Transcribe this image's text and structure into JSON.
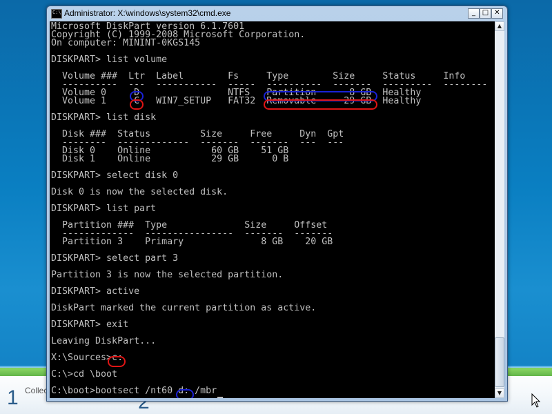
{
  "window": {
    "title": "Administrator: X:\\windows\\system32\\cmd.exe",
    "icon": "cmd-icon",
    "controls": {
      "minimize": "_",
      "maximize": "□",
      "close": "✕"
    }
  },
  "console": {
    "lines": [
      "Microsoft DiskPart version 6.1.7601",
      "Copyright (C) 1999-2008 Microsoft Corporation.",
      "On computer: MININT-0KGS145",
      "",
      "DISKPART> list volume",
      "",
      "  Volume ###  Ltr  Label        Fs     Type        Size     Status     Info",
      "  ----------  ---  -----------  -----  ----------  -------  ---------  --------",
      "  Volume 0     D                NTFS   Partition      8 GB  Healthy",
      "  Volume 1     C   WIN7_SETUP   FAT32  Removable     29 GB  Healthy",
      "",
      "DISKPART> list disk",
      "",
      "  Disk ###  Status         Size     Free     Dyn  Gpt",
      "  --------  -------------  -------  -------  ---  ---",
      "  Disk 0    Online           60 GB    51 GB",
      "  Disk 1    Online           29 GB      0 B",
      "",
      "DISKPART> select disk 0",
      "",
      "Disk 0 is now the selected disk.",
      "",
      "DISKPART> list part",
      "",
      "  Partition ###  Type              Size     Offset",
      "  -------------  ----------------  -------  -------",
      "  Partition 3    Primary              8 GB    20 GB",
      "",
      "DISKPART> select part 3",
      "",
      "Partition 3 is now the selected partition.",
      "",
      "DISKPART> active",
      "",
      "DiskPart marked the current partition as active.",
      "",
      "DISKPART> exit",
      "",
      "Leaving DiskPart...",
      "",
      "X:\\Sources>c:",
      "",
      "C:\\>cd \\boot",
      "",
      "C:\\boot>bootsect /nt60 d: /mbr"
    ]
  },
  "desktop": {
    "step_1": "1",
    "step_2": "2",
    "collect_label": "Collec",
    "accent": "#0a7fc2"
  },
  "annotations": {
    "blue": "#1a22d6",
    "red": "#e01515"
  }
}
